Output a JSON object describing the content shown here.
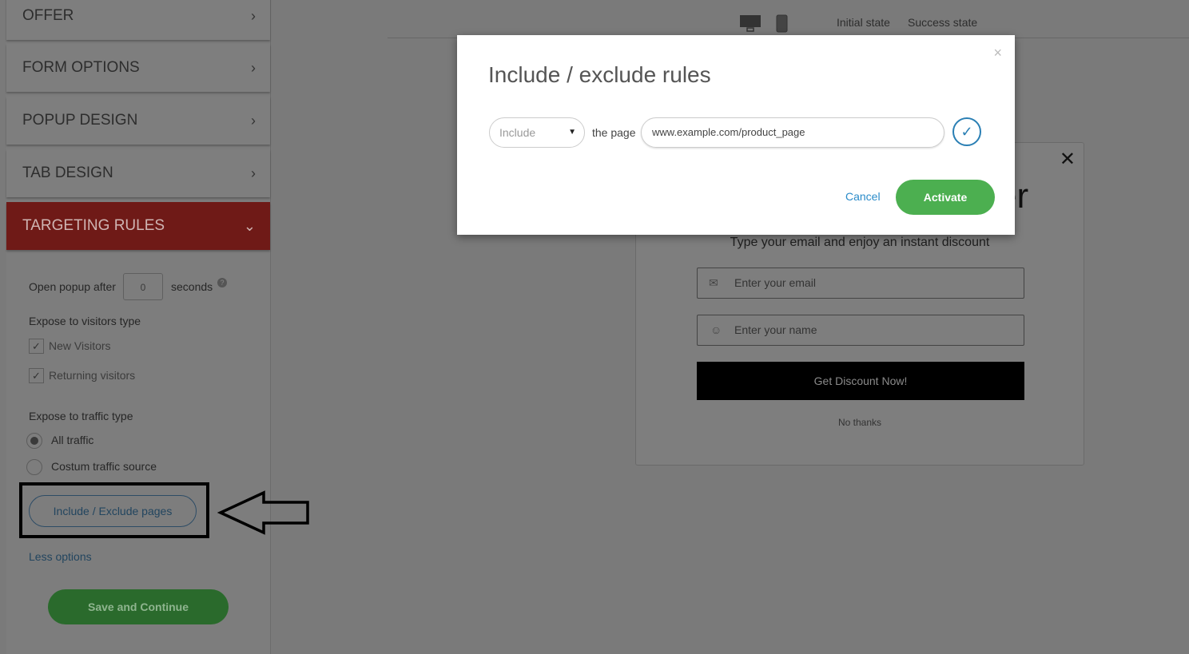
{
  "sidebar": {
    "sections": [
      {
        "label": "OFFER"
      },
      {
        "label": "FORM OPTIONS"
      },
      {
        "label": "POPUP DESIGN"
      },
      {
        "label": "TAB DESIGN"
      },
      {
        "label": "TARGETING RULES"
      }
    ],
    "open_after_label": "Open popup after",
    "open_after_value": "0",
    "seconds_label": "seconds",
    "help_icon": "question-circle-icon",
    "visitors_title": "Expose to visitors type",
    "visitors": [
      {
        "label": "New Visitors",
        "checked": true
      },
      {
        "label": "Returning visitors",
        "checked": true
      }
    ],
    "traffic_title": "Expose to traffic type",
    "traffic": [
      {
        "label": "All traffic",
        "selected": true
      },
      {
        "label": "Costum traffic source",
        "selected": false
      }
    ],
    "include_exclude_label": "Include / Exclude pages",
    "less_options": "Less options",
    "save_label": "Save and Continue"
  },
  "topbar": {
    "initial_state": "Initial state",
    "success_state": "Success state"
  },
  "preview": {
    "heading_fragment": "er",
    "subtitle": "Type your email and enjoy an instant discount",
    "email_placeholder": "Enter your email",
    "name_placeholder": "Enter your name",
    "cta": "Get Discount Now!",
    "no_thanks": "No thanks"
  },
  "modal": {
    "title": "Include / exclude rules",
    "mode": "Include",
    "the_page": "the page",
    "url": "www.example.com/product_page",
    "cancel": "Cancel",
    "activate": "Activate",
    "close": "×"
  },
  "colors": {
    "accent_red": "#c62828",
    "green": "#4caf50",
    "link_blue": "#2a8bc9"
  }
}
